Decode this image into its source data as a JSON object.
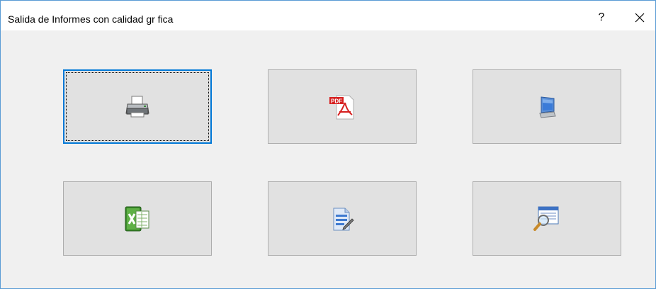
{
  "window": {
    "title": "Salida de Informes con calidad gr fica",
    "help_label": "?"
  },
  "buttons": [
    {
      "id": "print",
      "icon": "printer-icon"
    },
    {
      "id": "pdf",
      "icon": "pdf-icon",
      "icon_text": "PDF"
    },
    {
      "id": "screen",
      "icon": "monitor-icon"
    },
    {
      "id": "excel",
      "icon": "excel-icon"
    },
    {
      "id": "edit",
      "icon": "document-edit-icon"
    },
    {
      "id": "preview",
      "icon": "magnifier-preview-icon"
    }
  ],
  "colors": {
    "window_border": "#5a9bd5",
    "focus_border": "#0078d7",
    "button_face": "#e1e1e1",
    "background": "#f0f0f0"
  }
}
